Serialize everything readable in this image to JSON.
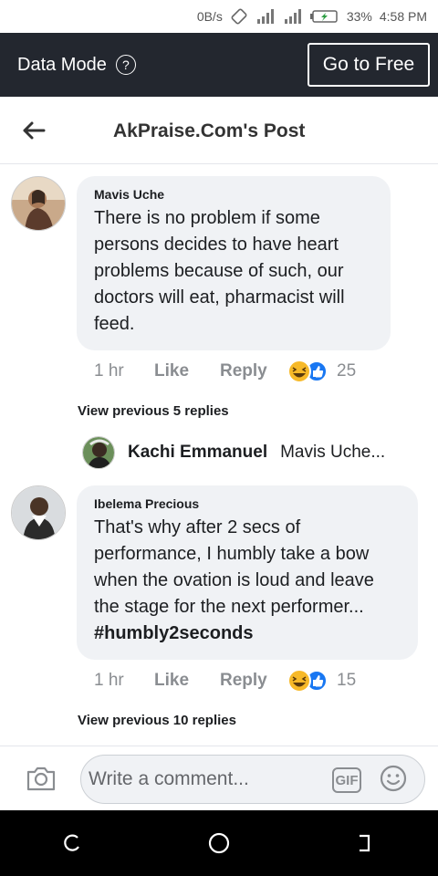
{
  "status_bar": {
    "speed": "0B/s",
    "battery": "33%",
    "time": "4:58 PM"
  },
  "data_bar": {
    "label": "Data Mode",
    "help_glyph": "?",
    "free_button": "Go to Free"
  },
  "header": {
    "title": "AkPraise.Com's Post"
  },
  "comments": [
    {
      "author": "Mavis Uche",
      "text": "There is no problem if some persons decides to have heart problems because of such, our doctors will eat, pharmacist will feed.",
      "time": "1 hr",
      "like": "Like",
      "reply": "Reply",
      "reaction_count": "25",
      "view_previous": "View previous 5 replies"
    },
    {
      "author": "Ibelema Precious",
      "text": "That's why after 2 secs of performance, I humbly take a bow when the ovation is loud and leave the stage for the next performer...",
      "hashtag": "#humbly2seconds",
      "time": "1 hr",
      "like": "Like",
      "reply": "Reply",
      "reaction_count": "15",
      "view_previous": "View previous 10 replies"
    }
  ],
  "reply_preview": {
    "author": "Kachi Emmanuel",
    "text": "Mavis Uche..."
  },
  "composer": {
    "placeholder": "Write a comment...",
    "gif_label": "GIF"
  },
  "icons": {
    "back": "back-arrow-icon",
    "camera": "camera-icon",
    "emoji": "emoji-icon",
    "reaction_haha": "haha-reaction-icon",
    "reaction_like": "like-reaction-icon"
  },
  "colors": {
    "data_bar_bg": "#23272f",
    "bubble_bg": "#f0f2f5",
    "like_blue": "#1877f2",
    "haha_yellow": "#f7b928"
  }
}
